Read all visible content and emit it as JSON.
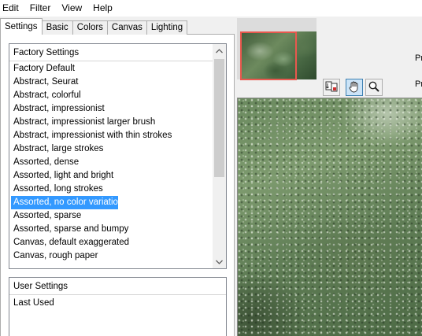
{
  "menu": [
    "Edit",
    "Filter",
    "View",
    "Help"
  ],
  "tabs": [
    "Settings",
    "Basic",
    "Colors",
    "Canvas",
    "Lighting"
  ],
  "factory": {
    "header": "Factory Settings",
    "items": [
      "Factory Default",
      "Abstract, Seurat",
      "Abstract, colorful",
      "Abstract, impressionist",
      "Abstract, impressionist larger brush",
      "Abstract, impressionist with thin strokes",
      "Abstract, large strokes",
      "Assorted, dense",
      "Assorted, light and bright",
      "Assorted, long strokes",
      "Assorted, no color variation",
      "Assorted, sparse",
      "Assorted, sparse and bumpy",
      "Canvas, default exaggerated",
      "Canvas, rough paper"
    ],
    "selected_index": 10
  },
  "user": {
    "header": "User Settings",
    "items": [
      "Last Used"
    ]
  },
  "side_labels": [
    "Pr",
    "Pr"
  ],
  "icons": {
    "swap": "swap-preview-icon",
    "hand": "hand-tool-icon",
    "zoom": "zoom-tool-icon",
    "up": "scroll-up-icon",
    "down": "scroll-down-icon"
  },
  "colors": {
    "selection": "#3399ff",
    "thumb_frame": "#e8584e"
  }
}
